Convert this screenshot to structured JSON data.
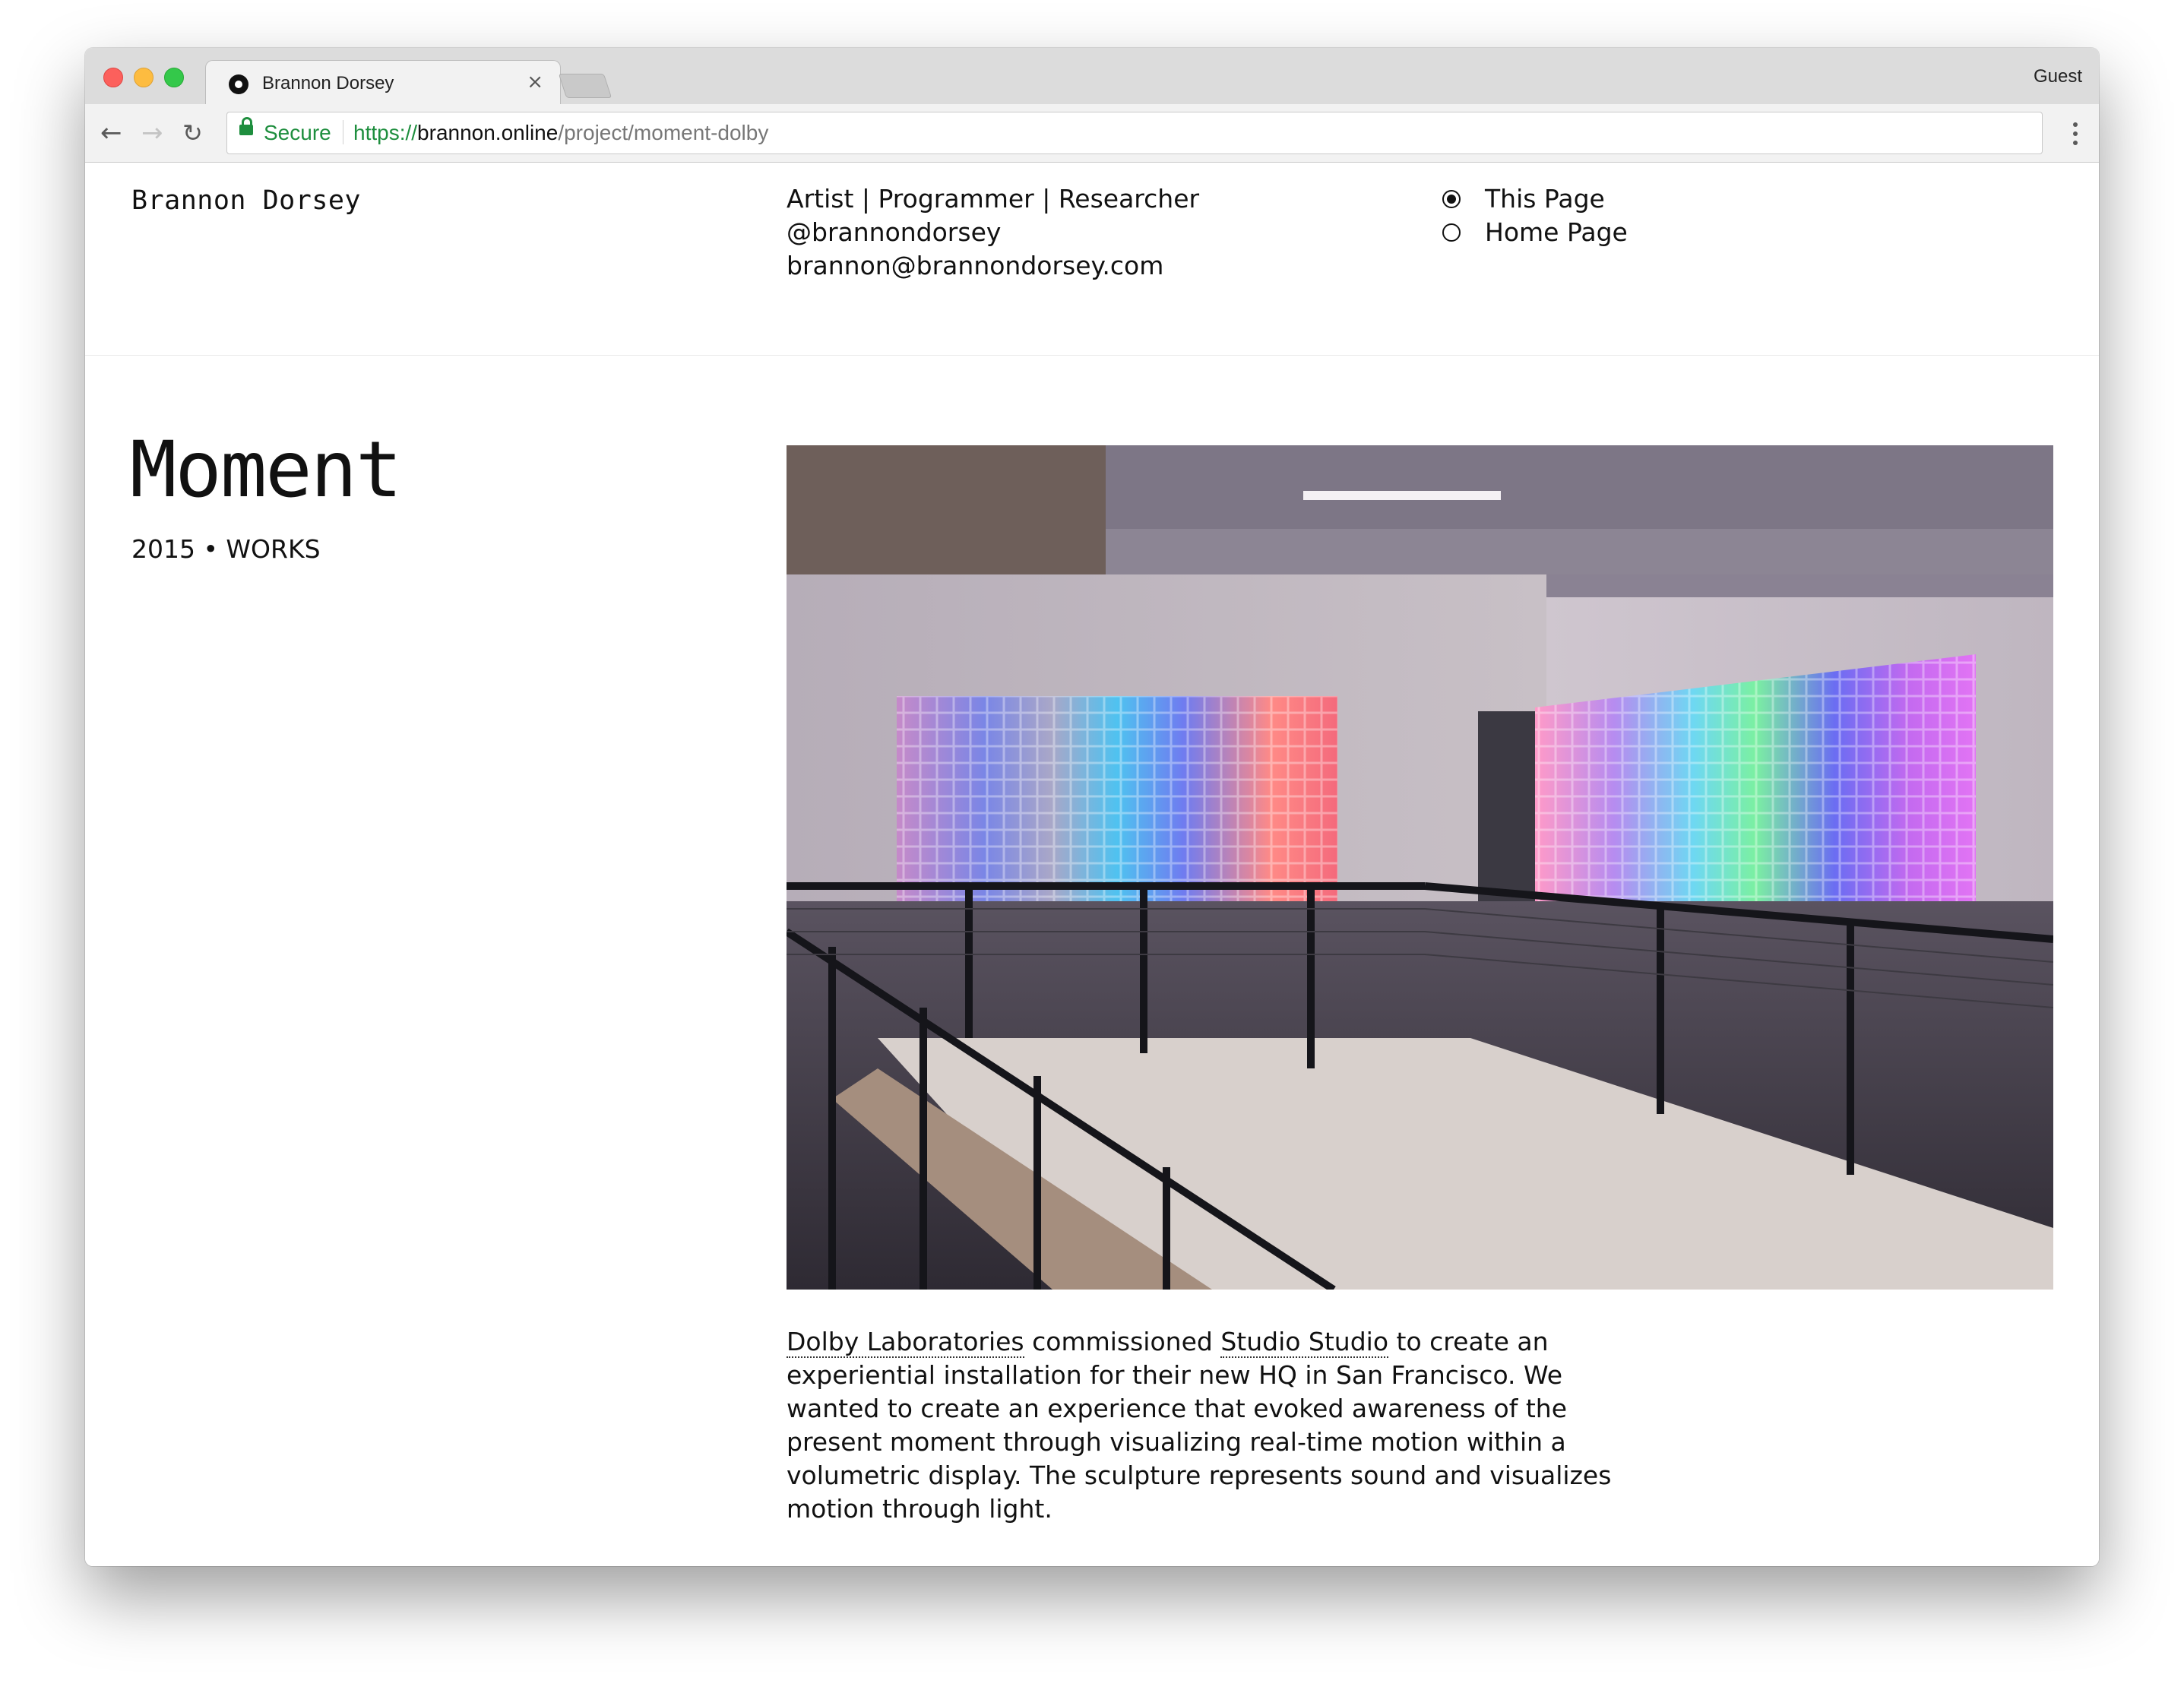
{
  "browser": {
    "tab_title": "Brannon Dorsey",
    "tab_close": "×",
    "profile": "Guest",
    "secure_label": "Secure",
    "url_scheme": "https://",
    "url_host": "brannon.online",
    "url_path": "/project/moment-dolby",
    "icons": {
      "back": "arrow-left-icon",
      "forward": "arrow-right-icon",
      "reload": "reload-icon",
      "lock": "lock-icon",
      "menu": "more-vertical-icon",
      "favicon": "site-favicon-icon"
    },
    "colors": {
      "secure": "#1e8e3e",
      "close": "#fc605c",
      "minimize": "#fdbc40",
      "maximize": "#34c84a"
    }
  },
  "header": {
    "site_name": "Brannon Dorsey",
    "tagline": "Artist | Programmer | Researcher",
    "handle": "@brannondorsey",
    "email": "brannon@brannondorsey.com",
    "nav": [
      {
        "label": "This Page",
        "selected": true
      },
      {
        "label": "Home Page",
        "selected": false
      }
    ]
  },
  "project": {
    "title": "Moment",
    "meta": "2015 • WORKS",
    "description": {
      "link1": "Dolby Laboratories",
      "text1": " commissioned ",
      "link2": "Studio Studio",
      "text2": " to create an experiential installation for their new HQ in San Francisco. We wanted to create an experience that evoked awareness of the present moment through visualizing real-time motion within a volumetric display. The sculpture represents sound and visualizes motion through light."
    }
  }
}
